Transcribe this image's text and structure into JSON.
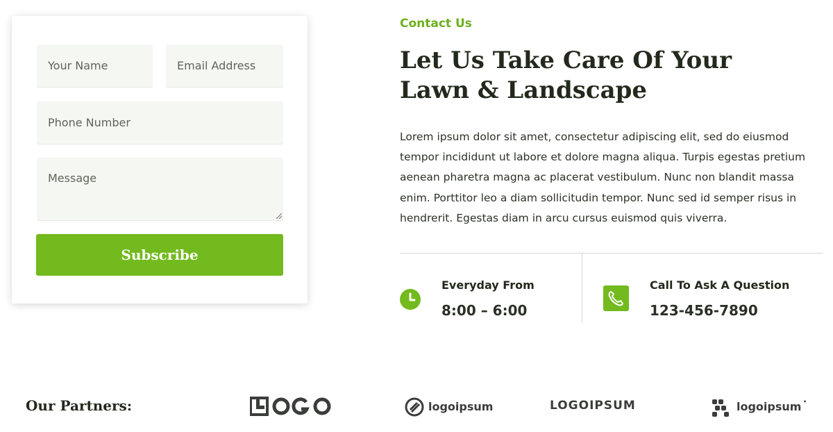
{
  "form": {
    "name_placeholder": "Your Name",
    "email_placeholder": "Email Address",
    "phone_placeholder": "Phone Number",
    "message_placeholder": "Message",
    "submit_label": "Subscribe"
  },
  "contact": {
    "eyebrow": "Contact Us",
    "headline_line1": "Let Us Take Care Of Your",
    "headline_line2": "Lawn & Landscape",
    "body": "Lorem ipsum dolor sit amet, consectetur adipiscing elit, sed do eiusmod tempor incididunt ut labore et dolore magna aliqua. Turpis egestas pretium aenean pharetra magna ac placerat vestibulum. Nunc non blandit massa enim. Porttitor leo a diam sollicitudin tempor. Nunc sed id semper risus in hendrerit. Egestas diam in arcu cursus euismod quis viverra."
  },
  "info": [
    {
      "icon": "clock-icon",
      "title": "Everyday From",
      "value": "8:00 – 6:00"
    },
    {
      "icon": "phone-icon",
      "title": "Call To Ask A Question",
      "value": "123-456-7890"
    }
  ],
  "partners": {
    "label": "Our Partners:",
    "logos": [
      {
        "icon": "logo-blocks-icon",
        "text": "LOGO"
      },
      {
        "icon": "logo-circle-icon",
        "text": "logoipsum"
      },
      {
        "icon": "logo-wordmark-icon",
        "text": "LOGOIPSUM"
      },
      {
        "icon": "logo-dots-icon",
        "text": "logoipsum"
      }
    ]
  },
  "colors": {
    "accent": "#72ba1e",
    "field_bg": "#f5f7f3",
    "heading": "#23291c"
  }
}
